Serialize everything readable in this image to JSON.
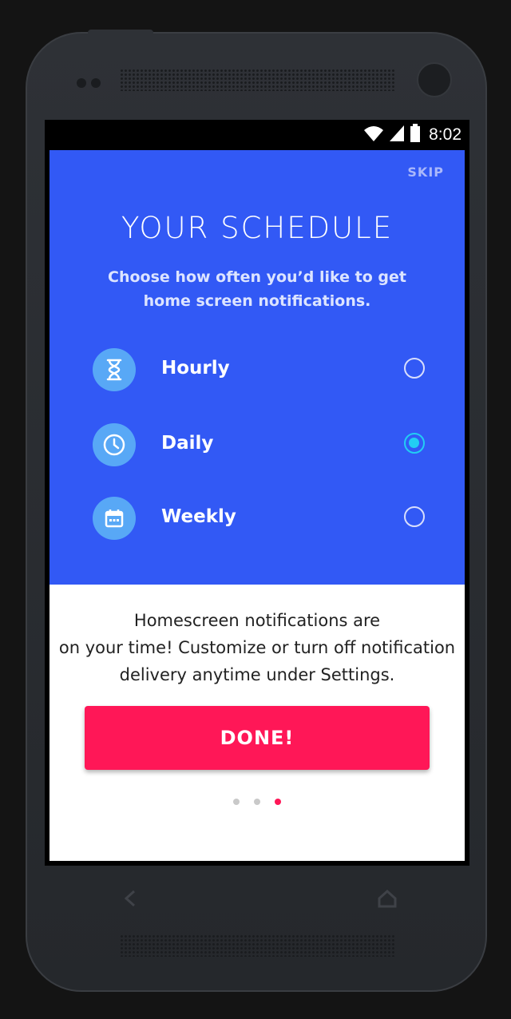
{
  "status_bar": {
    "time": "8:02",
    "icons": [
      "wifi-icon",
      "signal-icon",
      "battery-icon"
    ]
  },
  "onboarding": {
    "skip_label": "SKIP",
    "title": "YOUR SCHEDULE",
    "subtitle_line1": "Choose how often you’d like to get",
    "subtitle_line2": "home screen notifications.",
    "options": [
      {
        "label": "Hourly",
        "icon": "hourglass-icon",
        "selected": false
      },
      {
        "label": "Daily",
        "icon": "clock-icon",
        "selected": true
      },
      {
        "label": "Weekly",
        "icon": "calendar-icon",
        "selected": false
      }
    ],
    "info_line1": "Homescreen notifications are",
    "info_line2": "on your time! Customize or turn off notification",
    "info_line3": "delivery anytime under Settings.",
    "done_label": "DONE!",
    "page_count": 3,
    "active_page": 3
  },
  "colors": {
    "hero_bg": "#3259f5",
    "icon_circle": "#58a8f6",
    "radio_selected": "#22cdf4",
    "accent": "#ff1757"
  }
}
